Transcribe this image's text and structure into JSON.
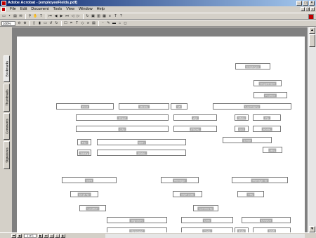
{
  "window": {
    "title": "Adobe Acrobat - [employeeFields.pdf]",
    "minimize": "_",
    "maximize": "□",
    "close": "×"
  },
  "menubar": {
    "items": [
      "File",
      "Edit",
      "Document",
      "Tools",
      "View",
      "Window",
      "Help"
    ]
  },
  "toolbar": {
    "zoom_value": "100%"
  },
  "navtabs": [
    "Bookmarks",
    "Thumbnails",
    "Comments",
    "Signatures"
  ],
  "fields": [
    {
      "label": "Employee"
    },
    {
      "label": "Department"
    },
    {
      "label": "Position"
    },
    {
      "label": "First"
    },
    {
      "label": "Middle"
    },
    {
      "label": "MI"
    },
    {
      "label": "Last Name"
    },
    {
      "label": "Street"
    },
    {
      "label": "Apt"
    },
    {
      "label": "State"
    },
    {
      "label": "Zip"
    },
    {
      "label": "City"
    },
    {
      "label": "Phone"
    },
    {
      "label": "Ext"
    },
    {
      "label": "Home"
    },
    {
      "label": "Email"
    },
    {
      "label": "Fax"
    },
    {
      "label": "Birth"
    },
    {
      "label": "Hire"
    },
    {
      "label": "Salary"
    },
    {
      "label": "Status"
    },
    {
      "label": "SSN"
    },
    {
      "label": "Manager"
    },
    {
      "label": "Manager ID"
    },
    {
      "label": "Dept No"
    },
    {
      "label": "Start Date"
    },
    {
      "label": "Title"
    },
    {
      "label": "Location"
    },
    {
      "label": "Comments"
    },
    {
      "label": "Signature"
    },
    {
      "label": "Date"
    },
    {
      "label": "Division"
    },
    {
      "label": "Reviewed"
    },
    {
      "label": "Code"
    },
    {
      "label": "Rate"
    },
    {
      "label": "Shift"
    },
    {
      "label": "Notes"
    }
  ],
  "statusbar": {
    "page_indicator": "1 of 1"
  }
}
